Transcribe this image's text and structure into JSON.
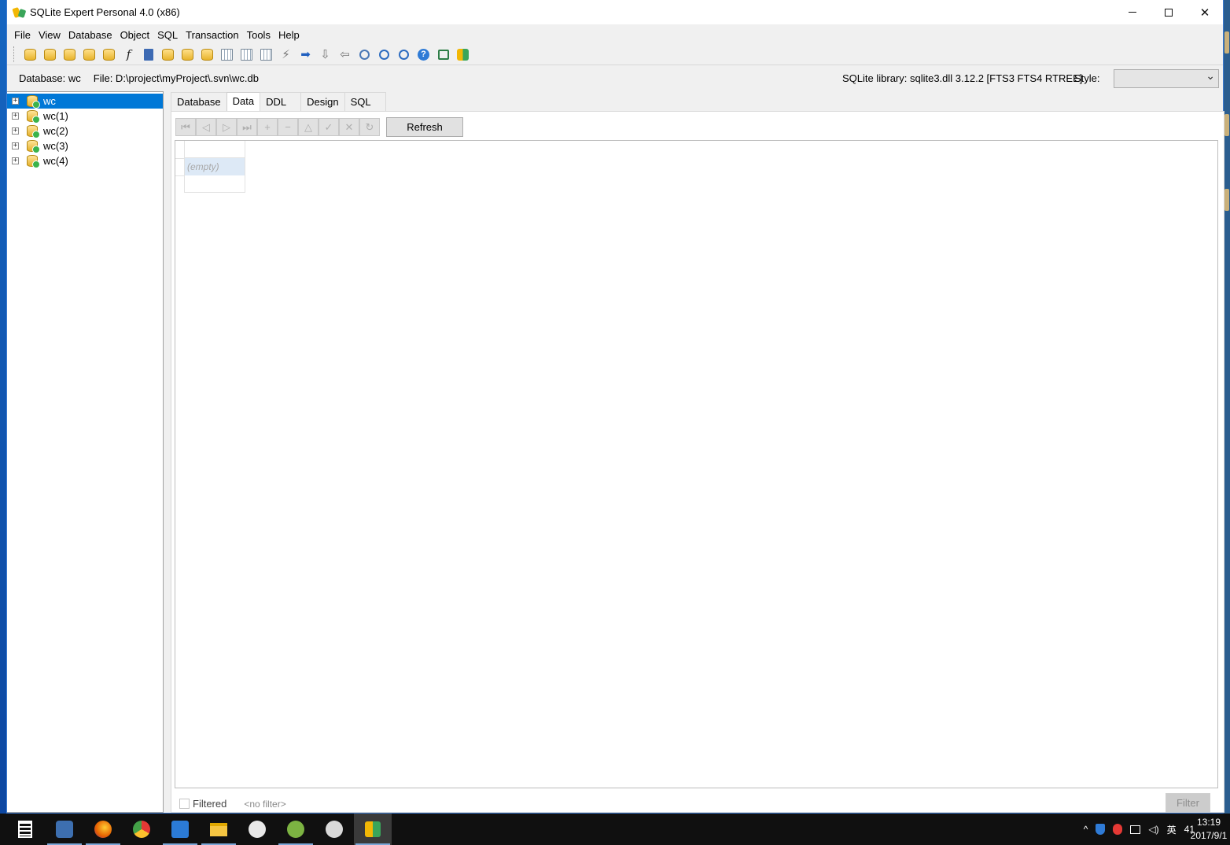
{
  "window": {
    "title": "SQLite Expert Personal 4.0 (x86)"
  },
  "menu": [
    "File",
    "View",
    "Database",
    "Object",
    "SQL",
    "Transaction",
    "Tools",
    "Help"
  ],
  "toolbar": {
    "icons": [
      "new-database-icon",
      "add-database-icon",
      "remove-database-icon",
      "edit-database-icon",
      "attach-database-icon",
      "function-icon",
      "book-icon",
      "import-icon",
      "export-icon",
      "database-options-icon",
      "table-icon",
      "table-view-icon",
      "new-table-icon",
      "query-icon",
      "forward-arrow-icon",
      "down-arrow-icon",
      "back-arrow-icon",
      "settings-icon",
      "cloud-upload-icon",
      "cloud-download-icon",
      "help-icon",
      "window-icon",
      "app-logo-icon"
    ]
  },
  "info": {
    "database": "Database: wc",
    "file": "File: D:\\project\\myProject\\.svn\\wc.db",
    "library": "SQLite library: sqlite3.dll 3.12.2 [FTS3 FTS4 RTREE]",
    "style_label": "Style:",
    "style_value": ""
  },
  "tree": {
    "expander": "+",
    "items": [
      {
        "label": "wc"
      },
      {
        "label": "wc(1)"
      },
      {
        "label": "wc(2)"
      },
      {
        "label": "wc(3)"
      },
      {
        "label": "wc(4)"
      }
    ]
  },
  "tabs": [
    "Database",
    "Data",
    "DDL",
    "Design",
    "SQL"
  ],
  "active_tab": "Data",
  "nav": {
    "buttons": [
      {
        "name": "first-record-button",
        "glyph": "⏮"
      },
      {
        "name": "prior-record-button",
        "glyph": "◁"
      },
      {
        "name": "next-record-button",
        "glyph": "▷"
      },
      {
        "name": "last-record-button",
        "glyph": "⏭"
      },
      {
        "name": "insert-record-button",
        "glyph": "+"
      },
      {
        "name": "delete-record-button",
        "glyph": "−"
      },
      {
        "name": "edit-record-button",
        "glyph": "△"
      },
      {
        "name": "post-edit-button",
        "glyph": "✓"
      },
      {
        "name": "cancel-edit-button",
        "glyph": "✕"
      },
      {
        "name": "refresh-data-button",
        "glyph": "↻"
      }
    ],
    "refresh_label": "Refresh"
  },
  "grid": {
    "empty_text": "(empty)"
  },
  "filter": {
    "checkbox_label": "Filtered",
    "no_filter_text": "<no filter>",
    "button_label": "Filter"
  },
  "taskbar": {
    "apps": [
      {
        "name": "calculator-icon",
        "color": "#ffffff"
      },
      {
        "name": "app-penguin-icon",
        "color": "#3d6fb0"
      },
      {
        "name": "firefox-icon",
        "color": "#e66000"
      },
      {
        "name": "chrome-icon",
        "color": "#4caf50"
      },
      {
        "name": "visual-studio-code-icon",
        "color": "#2b7bd6"
      },
      {
        "name": "file-explorer-icon",
        "color": "#f5c542"
      },
      {
        "name": "drop-app-icon",
        "color": "#e8e8e8"
      },
      {
        "name": "android-studio-icon",
        "color": "#7cb342"
      },
      {
        "name": "qq-icon",
        "color": "#d9d9d9"
      },
      {
        "name": "sqlite-expert-icon",
        "color": "#f2b705"
      }
    ],
    "tray": [
      "^",
      "shield-icon",
      "qq-tray-icon",
      "network-icon",
      "volume-icon",
      "英",
      "41"
    ],
    "time": "13:19",
    "date": "2017/9/1"
  },
  "colors": {
    "selection": "#0078d7",
    "accent": "#3c7bd1"
  }
}
